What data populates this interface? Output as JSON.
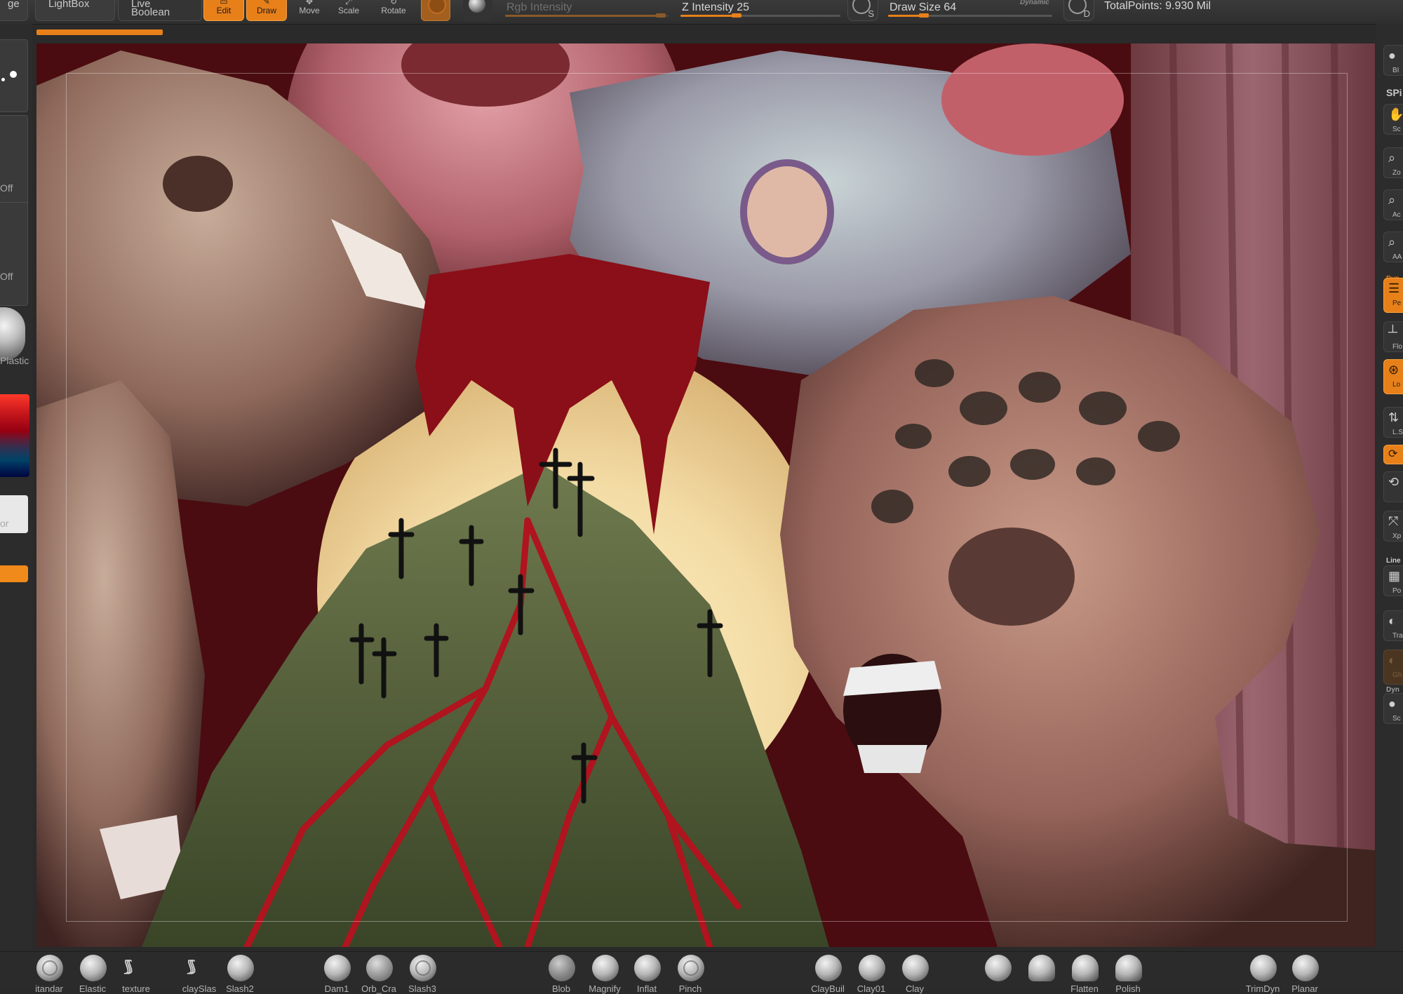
{
  "topbar": {
    "left_edge_label": "ge",
    "lightbox_label": "LightBox",
    "live_boolean_label": "Live Boolean",
    "tools": [
      {
        "label": "Edit",
        "active": true
      },
      {
        "label": "Draw",
        "active": true
      },
      {
        "label": "Move",
        "active": false
      },
      {
        "label": "Scale",
        "active": false
      },
      {
        "label": "Rotate",
        "active": false
      }
    ],
    "rgb_intensity": {
      "label": "Rgb Intensity",
      "level": 0.95
    },
    "z_intensity": {
      "label": "Z Intensity 25",
      "value": 25
    },
    "draw_size": {
      "label": "Draw Size 64",
      "value": 64,
      "dynamic_label": "Dynamic"
    },
    "s_key": "S",
    "d_key": "D",
    "total_points": "TotalPoints: 9.930 Mil",
    "progress_level": 0.12
  },
  "left_tray": {
    "off_label_1": "Off",
    "off_label_2": "Off",
    "material_label": "Plastic",
    "color_label": "or"
  },
  "right_tray": {
    "items": [
      {
        "icon": "sphere-icon",
        "text": "BI"
      },
      {
        "label": "SPi"
      },
      {
        "icon": "hand-icon",
        "text": "Sc"
      },
      {
        "icon": "zoom-icon",
        "text": "Zo"
      },
      {
        "icon": "actual-icon",
        "text": "Ac"
      },
      {
        "icon": "aahalf-icon",
        "text": "AA"
      },
      {
        "label": "Dyn",
        "text": "Pe"
      },
      {
        "icon": "floor-icon",
        "text": "Flo"
      },
      {
        "icon": "local-icon",
        "text": "Lo"
      },
      {
        "icon": "lsym-icon",
        "text": "L.S"
      },
      {
        "icon": "gyro-icon",
        "text": ""
      },
      {
        "icon": "xpose-icon",
        "text": "Xp"
      },
      {
        "label": "Line",
        "text": "Po"
      },
      {
        "icon": "transp-icon",
        "text": "Tra"
      },
      {
        "icon": "ghost-icon",
        "text": "Gh"
      },
      {
        "label": "Dyn",
        "text": "Sc"
      }
    ]
  },
  "bottom_shelf": {
    "brushes": [
      "itandar",
      "Elastic",
      "texture",
      "claySlas",
      "Slash2",
      "Dam1",
      "Orb_Cra",
      "Slash3",
      "Blob",
      "Magnify",
      "Inflat",
      "Pinch",
      "ClayBuil",
      "Clay01",
      "Clay",
      "",
      "",
      "Flatten",
      "Polish",
      "TrimDyn",
      "Planar"
    ]
  },
  "colors": {
    "accent": "#e8801a",
    "background": "#2a2a2a",
    "canvas_blood": "#5a1014"
  }
}
